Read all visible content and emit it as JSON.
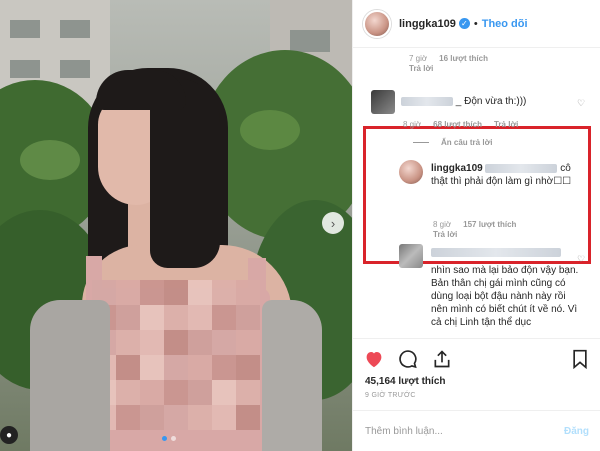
{
  "header": {
    "username": "linggka109",
    "separator": "•",
    "follow_label": "Theo dõi"
  },
  "comments": {
    "top_meta": {
      "time": "7 giờ",
      "likes": "16 lượt thích",
      "reply": "Trả lời"
    },
    "highlighted": {
      "text": "_ Độn vừa th:)))",
      "time": "8 giờ",
      "likes": "68 lượt thích",
      "reply": "Trả lời",
      "hide_replies": "Ẩn câu trả lời"
    },
    "owner_reply": {
      "username": "linggka109",
      "text": "cô thật thì phải độn làm gì nhờ☐☐"
    },
    "reply_meta": {
      "time": "8 giờ",
      "likes": "157 lượt thích",
      "reply": "Trả lời"
    },
    "last_comment": {
      "text": "nhìn sao mà lại bảo độn vậy bạn. Bản thân chị gái mình cũng có dùng loại bột đậu nành này rồi nên mình có biết chút ít về nó. Vì cả chị Linh tận thể dục"
    }
  },
  "actions": {
    "like_icon": "heart-icon",
    "comment_icon": "comment-icon",
    "share_icon": "share-icon",
    "save_icon": "bookmark-icon",
    "like_color": "#ed4956"
  },
  "likes_count": "45,164 lượt thích",
  "time_ago": "9 GIỜ TRƯỚC",
  "add_comment": {
    "placeholder": "Thêm bình luận...",
    "post_label": "Đăng"
  }
}
